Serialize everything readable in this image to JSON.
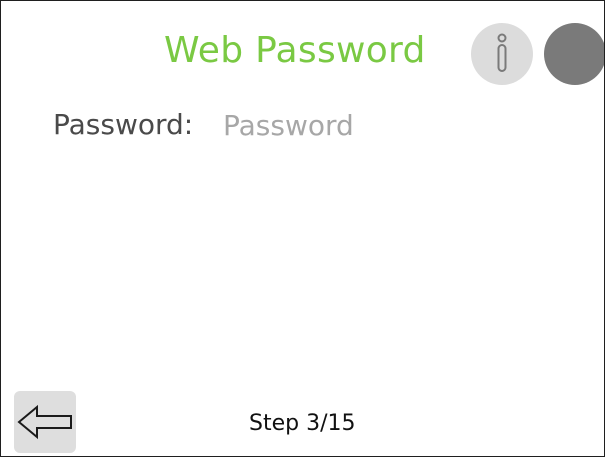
{
  "header": {
    "title": "Web Password",
    "title_color": "#7ac943",
    "info_icon": "info-icon",
    "status_indicator_color": "#7a7a7a"
  },
  "form": {
    "password_label": "Password:",
    "password_value": "",
    "password_placeholder": "Password"
  },
  "footer": {
    "back_icon": "arrow-left-icon",
    "step_text": "Step 3/15"
  }
}
